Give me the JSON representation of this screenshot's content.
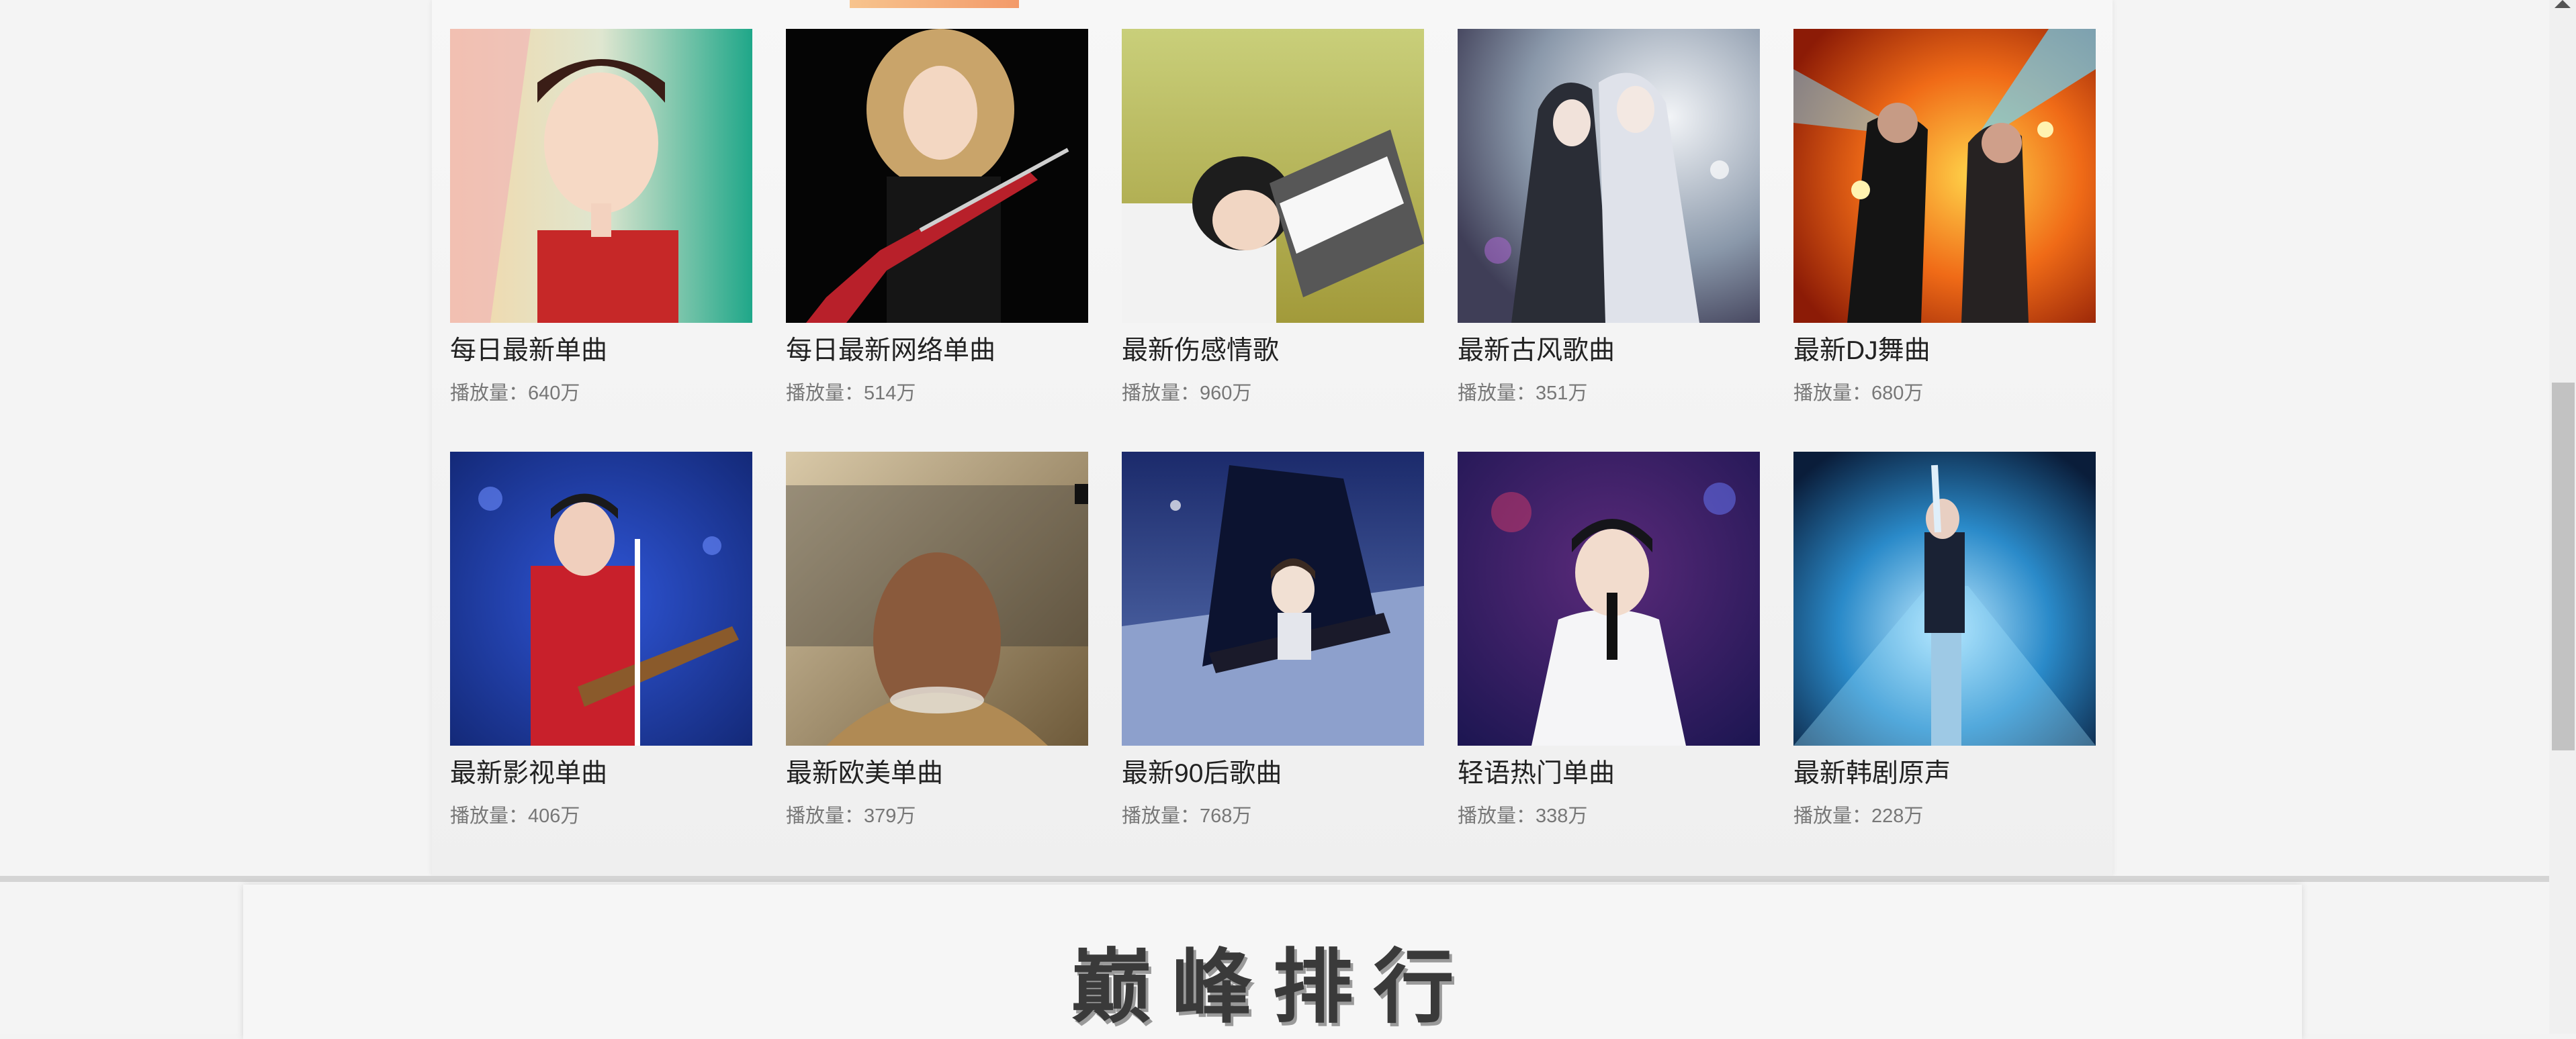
{
  "playlists_row1": [
    {
      "title": "每日最新单曲",
      "plays": "播放量：640万"
    },
    {
      "title": "每日最新网络单曲",
      "plays": "播放量：514万"
    },
    {
      "title": "最新伤感情歌",
      "plays": "播放量：960万"
    },
    {
      "title": "最新古风歌曲",
      "plays": "播放量：351万"
    },
    {
      "title": "最新DJ舞曲",
      "plays": "播放量：680万"
    }
  ],
  "playlists_row2": [
    {
      "title": "最新影视单曲",
      "plays": "播放量：406万"
    },
    {
      "title": "最新欧美单曲",
      "plays": "播放量：379万"
    },
    {
      "title": "最新90后歌曲",
      "plays": "播放量：768万"
    },
    {
      "title": "轻语热门单曲",
      "plays": "播放量：338万"
    },
    {
      "title": "最新韩剧原声",
      "plays": "播放量：228万"
    }
  ],
  "ranking": {
    "title": "巅峰排行"
  },
  "colors": {
    "accent_orange": "#f39a6a",
    "title_text": "#222222",
    "meta_text": "#777777"
  }
}
